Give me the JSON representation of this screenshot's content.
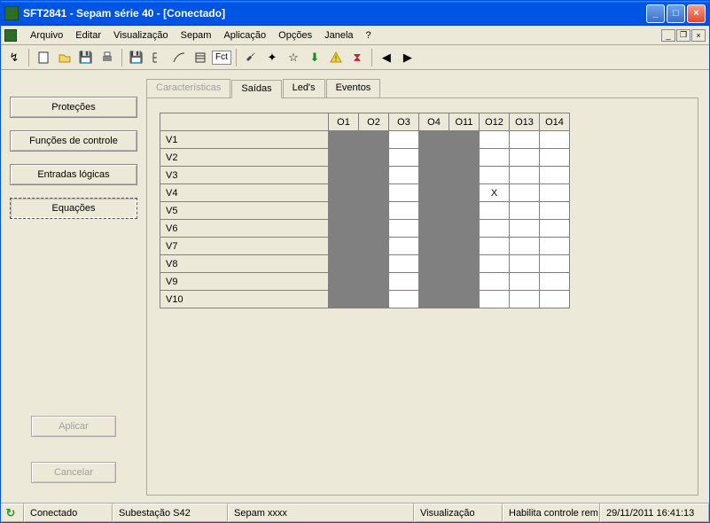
{
  "window": {
    "title": "SFT2841 - Sepam série 40 - [Conectado]"
  },
  "menu": {
    "items": [
      "Arquivo",
      "Editar",
      "Visualização",
      "Sepam",
      "Aplicação",
      "Opções",
      "Janela",
      "?"
    ]
  },
  "toolbar": {
    "fct_label": "Fct"
  },
  "sidebar": {
    "buttons": [
      {
        "label": "Proteções"
      },
      {
        "label": "Funções de controle"
      },
      {
        "label": "Entradas lógicas"
      },
      {
        "label": "Equações"
      }
    ],
    "selected_index": 3,
    "apply": "Aplicar",
    "cancel": "Cancelar"
  },
  "tabs": {
    "items": [
      "Características",
      "Saídas",
      "Led's",
      "Eventos"
    ],
    "active_index": 1
  },
  "grid": {
    "columns": [
      "O1",
      "O2",
      "O3",
      "O4",
      "O11",
      "O12",
      "O13",
      "O14"
    ],
    "rows": [
      "V1",
      "V2",
      "V3",
      "V4",
      "V5",
      "V6",
      "V7",
      "V8",
      "V9",
      "V10"
    ],
    "shaded_columns": [
      0,
      1,
      3,
      4
    ],
    "marks": [
      {
        "row": 3,
        "col": 5,
        "value": "X"
      }
    ]
  },
  "status": {
    "connected": "Conectado",
    "substation": "Subestação S42",
    "device": "Sepam xxxx",
    "mode": "Visualização",
    "enable": "Habilita controle rem",
    "datetime": "29/11/2011  16:41:13"
  }
}
